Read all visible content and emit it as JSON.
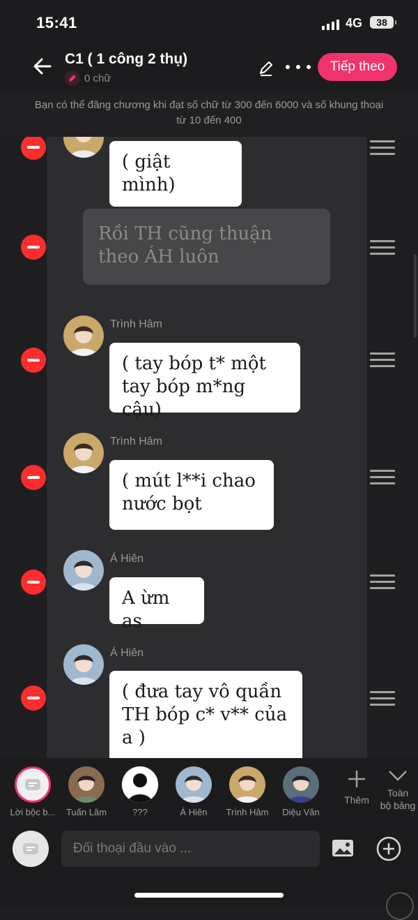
{
  "status": {
    "time": "15:41",
    "network": "4G",
    "battery": "38"
  },
  "header": {
    "back_icon": "arrow-left-icon",
    "title": "C1 ( 1 công 2 thụ)",
    "word_count": "0 chữ",
    "next_label": "Tiếp theo"
  },
  "notice": {
    "line1": "Bạn có thể đăng chương khi đạt số chữ từ 300 đến 6000 và số khung thoại",
    "line2": "từ 10 đến 400"
  },
  "messages": [
    {
      "speaker": "",
      "text": "( giật mình)"
    },
    {
      "type": "narration",
      "text": "Rồi TH cũng thuận theo ÁH luôn"
    },
    {
      "speaker": "Trình Hâm",
      "text": "( tay bóp t* một tay bóp m*ng cậu)"
    },
    {
      "speaker": "Trình Hâm",
      "text": "( mút l**i chao nước bọt"
    },
    {
      "speaker": "Á Hiên",
      "text": "A ừm as"
    },
    {
      "speaker": "Á Hiên",
      "text": "( đưa tay vô quần TH bóp c* v** của a )"
    }
  ],
  "characters": [
    {
      "name": "Lời bộc b..."
    },
    {
      "name": "Tuấn Lâm"
    },
    {
      "name": "???"
    },
    {
      "name": "Á Hiên"
    },
    {
      "name": "Trình Hâm"
    },
    {
      "name": "Diệu Văn"
    }
  ],
  "char_bar": {
    "add_label": "Thêm",
    "all_label_1": "Toàn",
    "all_label_2": "bộ bảng"
  },
  "input": {
    "placeholder": "Đối thoại đầu vào ..."
  },
  "colors": {
    "accent": "#f0336c",
    "remove": "#ff2d2d",
    "bubble": "#ffffff",
    "panel": "#2d2d2f"
  }
}
